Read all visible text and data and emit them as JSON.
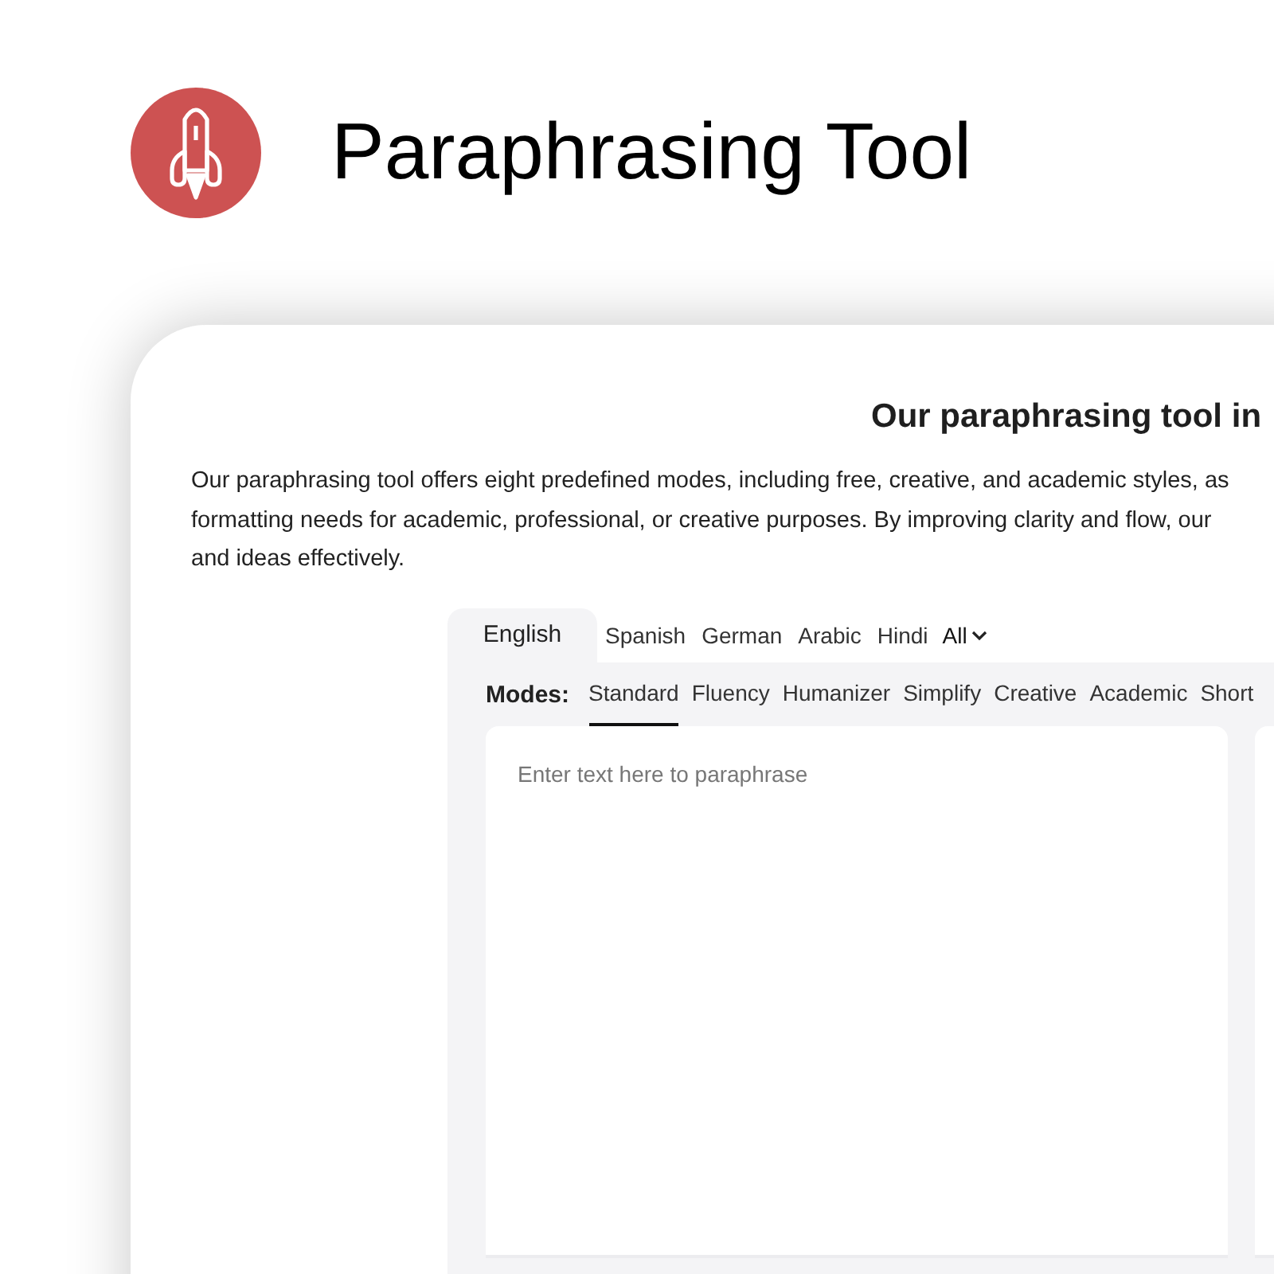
{
  "header": {
    "title": "Paraphrasing Tool"
  },
  "section": {
    "heading": "Our paraphrasing tool in",
    "description_lines": [
      "Our paraphrasing tool offers eight predefined modes, including free, creative, and academic styles, as",
      "formatting needs for academic, professional, or creative purposes. By improving clarity and flow, our",
      "and ideas effectively."
    ]
  },
  "languages": [
    {
      "label": "English",
      "selected": true
    },
    {
      "label": "Spanish",
      "selected": false
    },
    {
      "label": "German",
      "selected": false
    },
    {
      "label": "Arabic",
      "selected": false
    },
    {
      "label": "Hindi",
      "selected": false
    }
  ],
  "languages_more": {
    "label": "All"
  },
  "modes": {
    "label": "Modes:",
    "items": [
      {
        "label": "Standard",
        "selected": true
      },
      {
        "label": "Fluency",
        "selected": false
      },
      {
        "label": "Humanizer",
        "selected": false
      },
      {
        "label": "Simplify",
        "selected": false
      },
      {
        "label": "Creative",
        "selected": false
      },
      {
        "label": "Academic",
        "selected": false
      },
      {
        "label": "Short",
        "selected": false
      }
    ]
  },
  "input": {
    "placeholder": "Enter text here to paraphrase"
  }
}
